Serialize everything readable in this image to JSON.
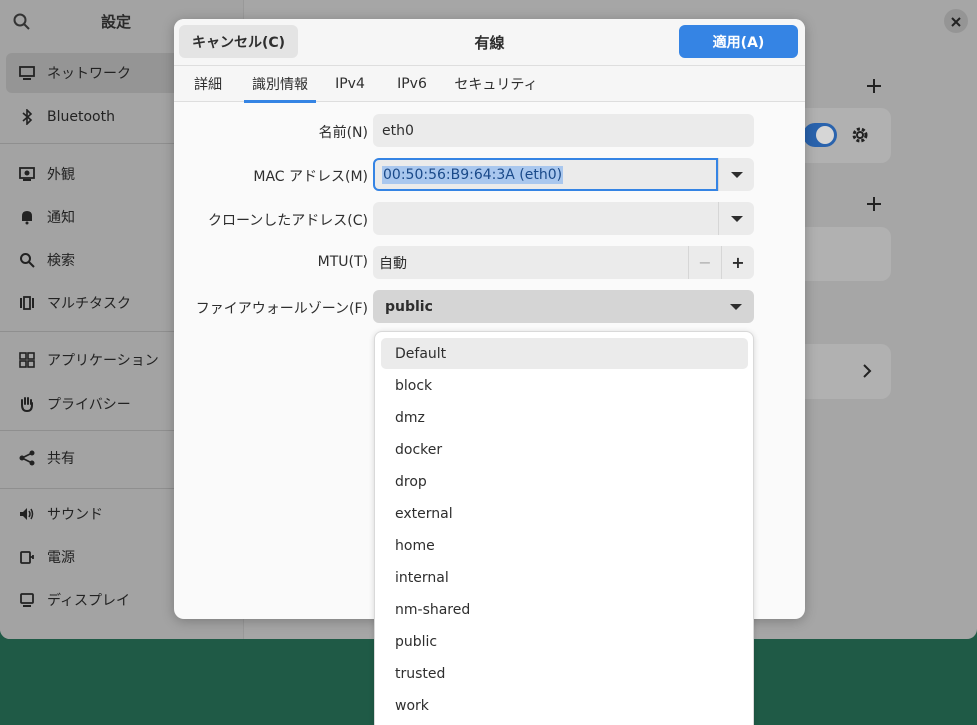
{
  "sidebar": {
    "title": "設定",
    "items": [
      {
        "label": "ネットワーク",
        "icon": "network-icon"
      },
      {
        "label": "Bluetooth",
        "icon": "bluetooth-icon"
      },
      {
        "label": "外観",
        "icon": "appearance-icon"
      },
      {
        "label": "通知",
        "icon": "bell-icon"
      },
      {
        "label": "検索",
        "icon": "search-icon"
      },
      {
        "label": "マルチタスク",
        "icon": "multitask-icon"
      },
      {
        "label": "アプリケーション",
        "icon": "apps-grid-icon"
      },
      {
        "label": "プライバシー",
        "icon": "hand-icon"
      },
      {
        "label": "共有",
        "icon": "share-icon"
      },
      {
        "label": "サウンド",
        "icon": "speaker-icon"
      },
      {
        "label": "電源",
        "icon": "power-icon"
      },
      {
        "label": "ディスプレイ",
        "icon": "display-icon"
      }
    ]
  },
  "dialog": {
    "title": "有線",
    "cancel_label": "キャンセル(C)",
    "apply_label": "適用(A)",
    "tabs": [
      "詳細",
      "識別情報",
      "IPv4",
      "IPv6",
      "セキュリティ"
    ],
    "active_tab": "識別情報",
    "form": {
      "name_label": "名前(N)",
      "name_value": "eth0",
      "mac_label": "MAC アドレス(M)",
      "mac_value": "00:50:56:B9:64:3A (eth0)",
      "clone_label": "クローンしたアドレス(C)",
      "clone_value": "",
      "mtu_label": "MTU(T)",
      "mtu_value": "自動",
      "mtu_minus": "−",
      "mtu_plus": "+",
      "zone_label": "ファイアウォールゾーン(F)",
      "zone_value": "public"
    }
  },
  "firewall_zone_options": [
    "Default",
    "block",
    "dmz",
    "docker",
    "drop",
    "external",
    "home",
    "internal",
    "nm-shared",
    "public",
    "trusted",
    "work"
  ],
  "hovered_option": "Default",
  "colors": {
    "accent": "#3584e4",
    "desktop": "#1f5a46"
  }
}
